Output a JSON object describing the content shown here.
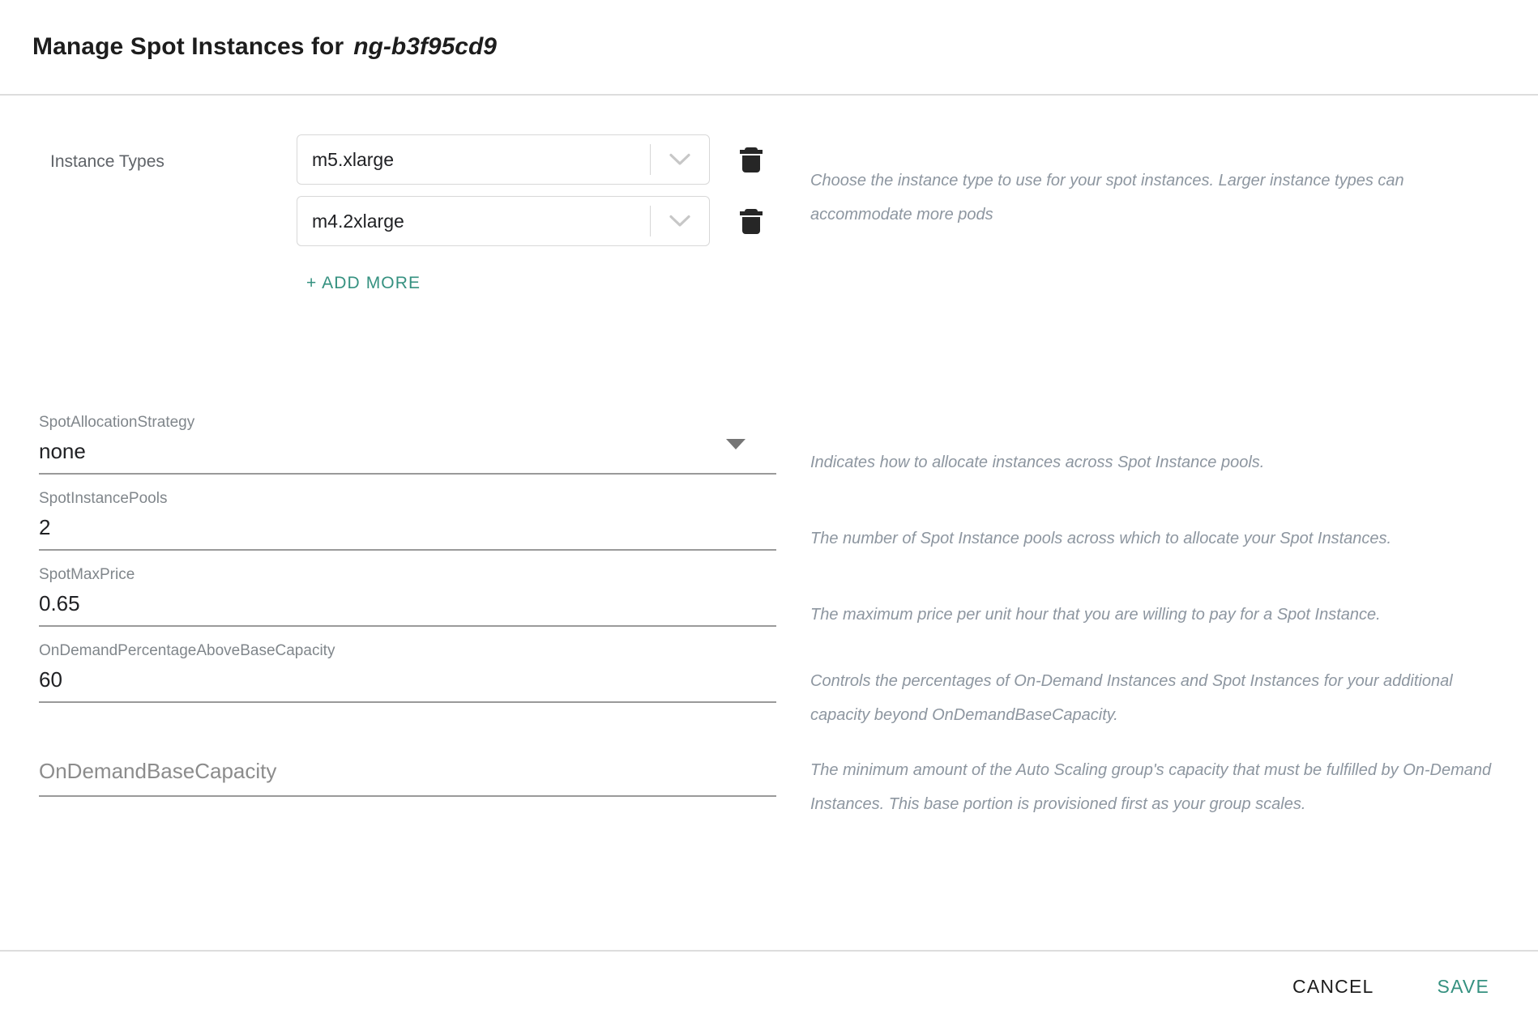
{
  "header": {
    "title": "Manage Spot Instances for",
    "target": "ng-b3f95cd9"
  },
  "instance_types": {
    "label": "Instance Types",
    "rows": [
      {
        "value": "m5.xlarge",
        "caret_icon": "chevron-down-icon",
        "delete_icon": "trash-icon"
      },
      {
        "value": "m4.2xlarge",
        "caret_icon": "chevron-down-icon",
        "delete_icon": "trash-icon"
      }
    ],
    "add_more_label": "+ ADD MORE",
    "help": "Choose the instance type to use for your spot instances. Larger instance types can accommodate more pods"
  },
  "fields": [
    {
      "label": "SpotAllocationStrategy",
      "value": "none",
      "type": "select",
      "arrow_icon": "triangle-down-icon",
      "help": "Indicates how to allocate instances across Spot Instance pools."
    },
    {
      "label": "SpotInstancePools",
      "value": "2",
      "type": "text",
      "help": "The number of Spot Instance pools across which to allocate your Spot Instances."
    },
    {
      "label": "SpotMaxPrice",
      "value": "0.65",
      "type": "text",
      "help": "The maximum price per unit hour that you are willing to pay for a Spot Instance."
    },
    {
      "label": "OnDemandPercentageAboveBaseCapacity",
      "value": "60",
      "type": "text",
      "help": "Controls the percentages of On-Demand Instances and Spot Instances for your additional capacity beyond OnDemandBaseCapacity."
    },
    {
      "label": "",
      "placeholder": "OnDemandBaseCapacity",
      "value": "",
      "type": "text-empty",
      "help": "The minimum amount of the Auto Scaling group's capacity that must be fulfilled by On-Demand Instances. This base portion is provisioned first as your group scales."
    }
  ],
  "footer": {
    "cancel_label": "CANCEL",
    "save_label": "SAVE"
  },
  "colors": {
    "accent": "#359180",
    "label_grey": "#80868b",
    "help_grey": "#8d96a0",
    "text": "#202124",
    "divider": "#dddddd",
    "underline": "#9a9a9a"
  }
}
